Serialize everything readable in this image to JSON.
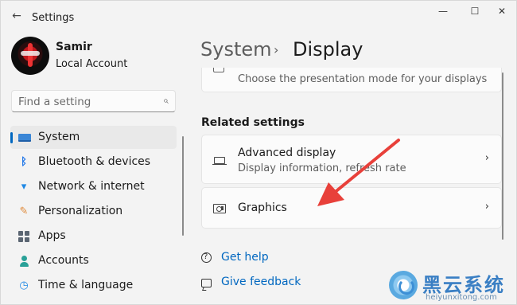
{
  "window": {
    "app_title": "Settings",
    "back_icon": "arrow-left-icon",
    "controls": {
      "minimize": "—",
      "maximize": "☐",
      "close": "✕"
    }
  },
  "profile": {
    "name": "Samir",
    "account_type": "Local Account"
  },
  "search": {
    "placeholder": "Find a setting",
    "icon": "⌕"
  },
  "sidebar": {
    "items": [
      {
        "label": "System",
        "icon": "system-icon",
        "selected": true
      },
      {
        "label": "Bluetooth & devices",
        "icon": "bluetooth-icon",
        "glyph": "ᛒ"
      },
      {
        "label": "Network & internet",
        "icon": "wifi-icon",
        "glyph": "▾"
      },
      {
        "label": "Personalization",
        "icon": "brush-icon",
        "glyph": "✎"
      },
      {
        "label": "Apps",
        "icon": "apps-icon"
      },
      {
        "label": "Accounts",
        "icon": "person-icon"
      },
      {
        "label": "Time & language",
        "icon": "globe-clock-icon",
        "glyph": "◷"
      }
    ]
  },
  "breadcrumb": {
    "parent": "System",
    "separator": "›",
    "current": "Display"
  },
  "main": {
    "partial_card_text": "Choose the presentation mode for your displays",
    "related_heading": "Related settings",
    "cards": [
      {
        "title": "Advanced display",
        "description": "Display information, refresh rate",
        "icon": "monitor-icon",
        "chevron": "›"
      },
      {
        "title": "Graphics",
        "icon": "graphics-card-icon",
        "chevron": "›"
      }
    ],
    "links": [
      {
        "label": "Get help",
        "icon": "help-icon"
      },
      {
        "label": "Give feedback",
        "icon": "feedback-icon"
      }
    ]
  },
  "annotation": {
    "arrow_color": "#e8403a"
  },
  "watermark": {
    "text": "黑云系统",
    "sub": "heiyunxitong.com"
  },
  "colors": {
    "accent": "#0067c0",
    "background": "#f3f3f3",
    "card": "#fbfbfb"
  }
}
